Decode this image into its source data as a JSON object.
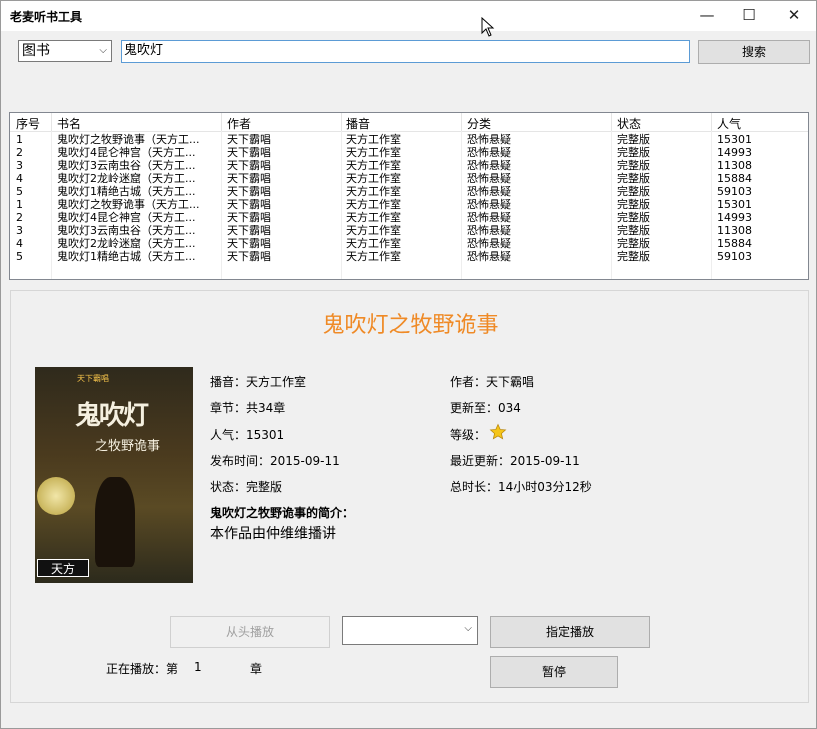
{
  "window": {
    "title": "老麦听书工具",
    "minimize": "—",
    "maximize": "☐",
    "close": "✕"
  },
  "search": {
    "category_selected": "图书",
    "query": "鬼吹灯",
    "button": "搜索"
  },
  "table": {
    "headers": [
      "序号",
      "书名",
      "作者",
      "播音",
      "分类",
      "状态",
      "人气"
    ],
    "rows": [
      [
        "1",
        "鬼吹灯之牧野诡事（天方工...",
        "天下霸唱",
        "天方工作室",
        "恐怖悬疑",
        "完整版",
        "15301"
      ],
      [
        "2",
        "鬼吹灯4昆仑神宫（天方工...",
        "天下霸唱",
        "天方工作室",
        "恐怖悬疑",
        "完整版",
        "14993"
      ],
      [
        "3",
        "鬼吹灯3云南虫谷（天方工...",
        "天下霸唱",
        "天方工作室",
        "恐怖悬疑",
        "完整版",
        "11308"
      ],
      [
        "4",
        "鬼吹灯2龙岭迷窟（天方工...",
        "天下霸唱",
        "天方工作室",
        "恐怖悬疑",
        "完整版",
        "15884"
      ],
      [
        "5",
        "鬼吹灯1精绝古城（天方工...",
        "天下霸唱",
        "天方工作室",
        "恐怖悬疑",
        "完整版",
        "59103"
      ],
      [
        "1",
        "鬼吹灯之牧野诡事（天方工...",
        "天下霸唱",
        "天方工作室",
        "恐怖悬疑",
        "完整版",
        "15301"
      ],
      [
        "2",
        "鬼吹灯4昆仑神宫（天方工...",
        "天下霸唱",
        "天方工作室",
        "恐怖悬疑",
        "完整版",
        "14993"
      ],
      [
        "3",
        "鬼吹灯3云南虫谷（天方工...",
        "天下霸唱",
        "天方工作室",
        "恐怖悬疑",
        "完整版",
        "11308"
      ],
      [
        "4",
        "鬼吹灯2龙岭迷窟（天方工...",
        "天下霸唱",
        "天方工作室",
        "恐怖悬疑",
        "完整版",
        "15884"
      ],
      [
        "5",
        "鬼吹灯1精绝古城（天方工...",
        "天下霸唱",
        "天方工作室",
        "恐怖悬疑",
        "完整版",
        "59103"
      ]
    ]
  },
  "detail": {
    "title": "鬼吹灯之牧野诡事",
    "cover": {
      "top_text": "天下霸唱",
      "main_text": "鬼吹灯",
      "sub_text": "之牧野诡事",
      "logo": "天方"
    },
    "narrator": "播音：天方工作室",
    "author": "作者：天下霸唱",
    "chapters": "章节：共34章",
    "updated_to": "更新至：034",
    "popularity": "人气：15301",
    "rating_label": "等级：",
    "rating_stars": 1,
    "published": "发布时间：2015-09-11",
    "last_update": "最近更新：2015-09-11",
    "status": "状态：完整版",
    "duration": "总时长：14小时03分12秒",
    "intro_label": "鬼吹灯之牧野诡事的简介：",
    "intro_text": "本作品由仲维维播讲"
  },
  "controls": {
    "play_from_start": "从头播放",
    "chapter_select_value": "",
    "play_specified": "指定播放",
    "pause": "暂停",
    "now_playing_prefix": "正在播放：第",
    "now_playing_chapter": "1",
    "now_playing_suffix": "章"
  },
  "colors": {
    "title_accent": "#ef8a26",
    "star": "#f5c518"
  }
}
